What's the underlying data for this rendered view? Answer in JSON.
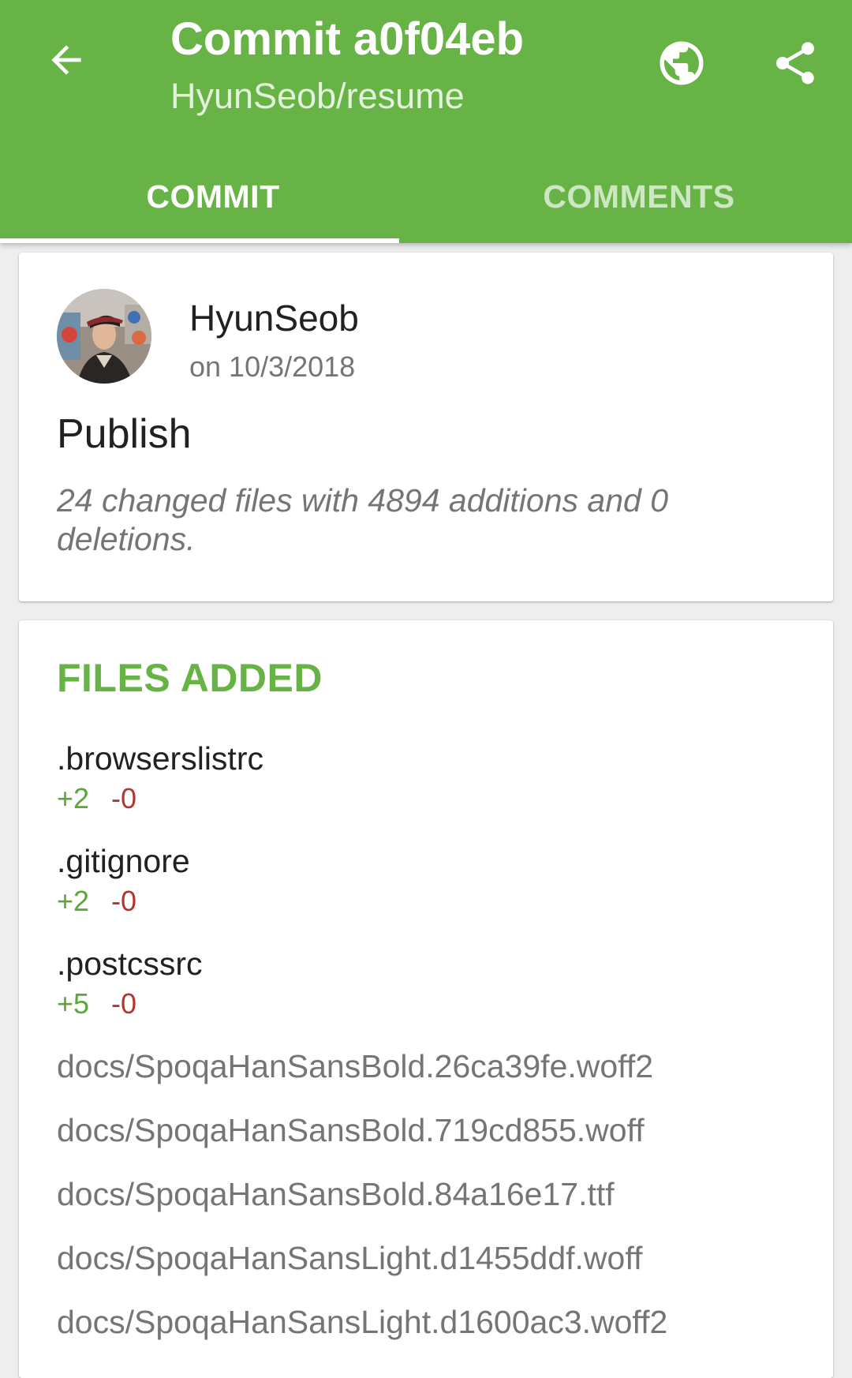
{
  "header": {
    "title": "Commit a0f04eb",
    "subtitle": "HyunSeob/resume",
    "icons": [
      "arrow-back-icon",
      "globe-icon",
      "share-icon"
    ]
  },
  "tabs": [
    {
      "label": "COMMIT",
      "active": true
    },
    {
      "label": "COMMENTS",
      "active": false
    }
  ],
  "commit": {
    "author": "HyunSeob",
    "date": "on 10/3/2018",
    "message": "Publish",
    "summary": "24 changed files with 4894 additions and 0 deletions."
  },
  "files": {
    "heading": "FILES ADDED",
    "items": [
      {
        "name": ".browserslistrc",
        "additions": "+2",
        "deletions": "-0"
      },
      {
        "name": ".gitignore",
        "additions": "+2",
        "deletions": "-0"
      },
      {
        "name": ".postcssrc",
        "additions": "+5",
        "deletions": "-0"
      }
    ],
    "binary_items": [
      "docs/SpoqaHanSansBold.26ca39fe.woff2",
      "docs/SpoqaHanSansBold.719cd855.woff",
      "docs/SpoqaHanSansBold.84a16e17.ttf",
      "docs/SpoqaHanSansLight.d1455ddf.woff",
      "docs/SpoqaHanSansLight.d1600ac3.woff2"
    ]
  },
  "colors": {
    "primary": "#67b346",
    "additions": "#5aa83a",
    "deletions": "#b3352f"
  }
}
